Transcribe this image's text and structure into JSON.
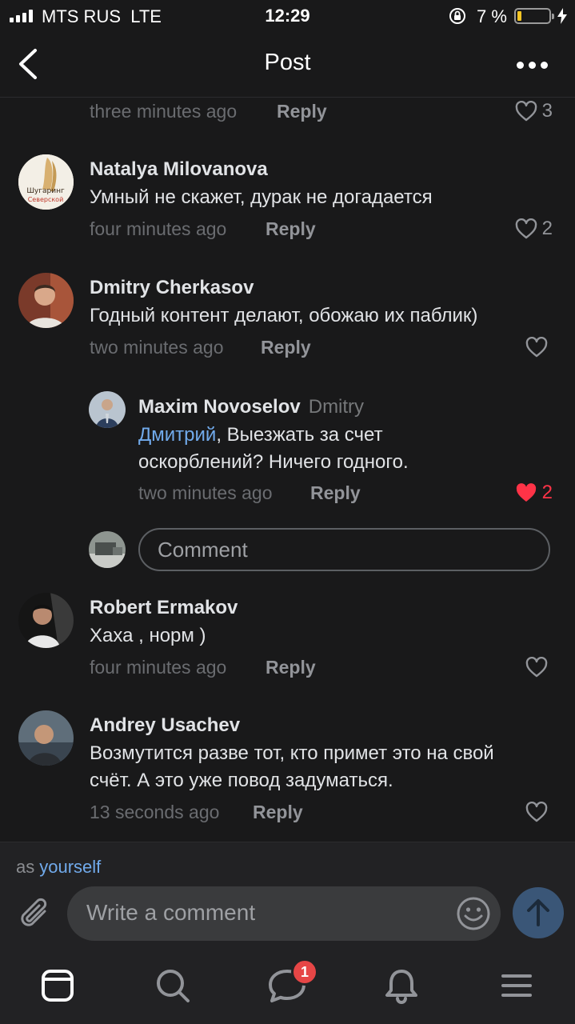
{
  "status_bar": {
    "carrier": "MTS RUS",
    "network": "LTE",
    "time": "12:29",
    "battery_percent": "7 %",
    "battery_level": 0.07
  },
  "header": {
    "title": "Post"
  },
  "comments": [
    {
      "time": "three minutes ago",
      "reply_label": "Reply",
      "likes": "3",
      "liked": false
    },
    {
      "author": "Natalya Milovanova",
      "text": "Умный не скажет, дурак не догадается",
      "time": "four minutes ago",
      "reply_label": "Reply",
      "likes": "2",
      "liked": false,
      "avatar_text": [
        "Шугаринг",
        "Северской"
      ]
    },
    {
      "author": "Dmitry Cherkasov",
      "text": "Годный контент делают, обожаю их паблик)",
      "time": "two minutes ago",
      "reply_label": "Reply",
      "likes": "",
      "liked": false
    },
    {
      "author": "Maxim Novoselov",
      "reply_to": "Dmitry",
      "mention": "Дмитрий",
      "text": ", Выезжать за счет оскорблений? Ничего годного.",
      "time": "two minutes ago",
      "reply_label": "Reply",
      "likes": "2",
      "liked": true
    },
    {
      "author": "Robert Ermakov",
      "text": "Хаха , норм )",
      "time": "four minutes ago",
      "reply_label": "Reply",
      "likes": "",
      "liked": false
    },
    {
      "author": "Andrey Usachev",
      "text": "Возмутится разве тот, кто примет это на свой счёт. А это уже повод задуматься.",
      "time": "13 seconds ago",
      "reply_label": "Reply",
      "likes": "",
      "liked": false
    }
  ],
  "thread_reply": {
    "placeholder": "Comment"
  },
  "composer": {
    "as_label": "as",
    "as_identity": "yourself",
    "placeholder": "Write a comment"
  },
  "tabbar": {
    "items": [
      "news-feed",
      "search",
      "messages",
      "notifications",
      "menu"
    ],
    "messages_badge": "1"
  },
  "colors": {
    "background": "#19191a",
    "accent_link": "#71aaeb",
    "like_active": "#ff3347",
    "badge": "#e64646"
  }
}
